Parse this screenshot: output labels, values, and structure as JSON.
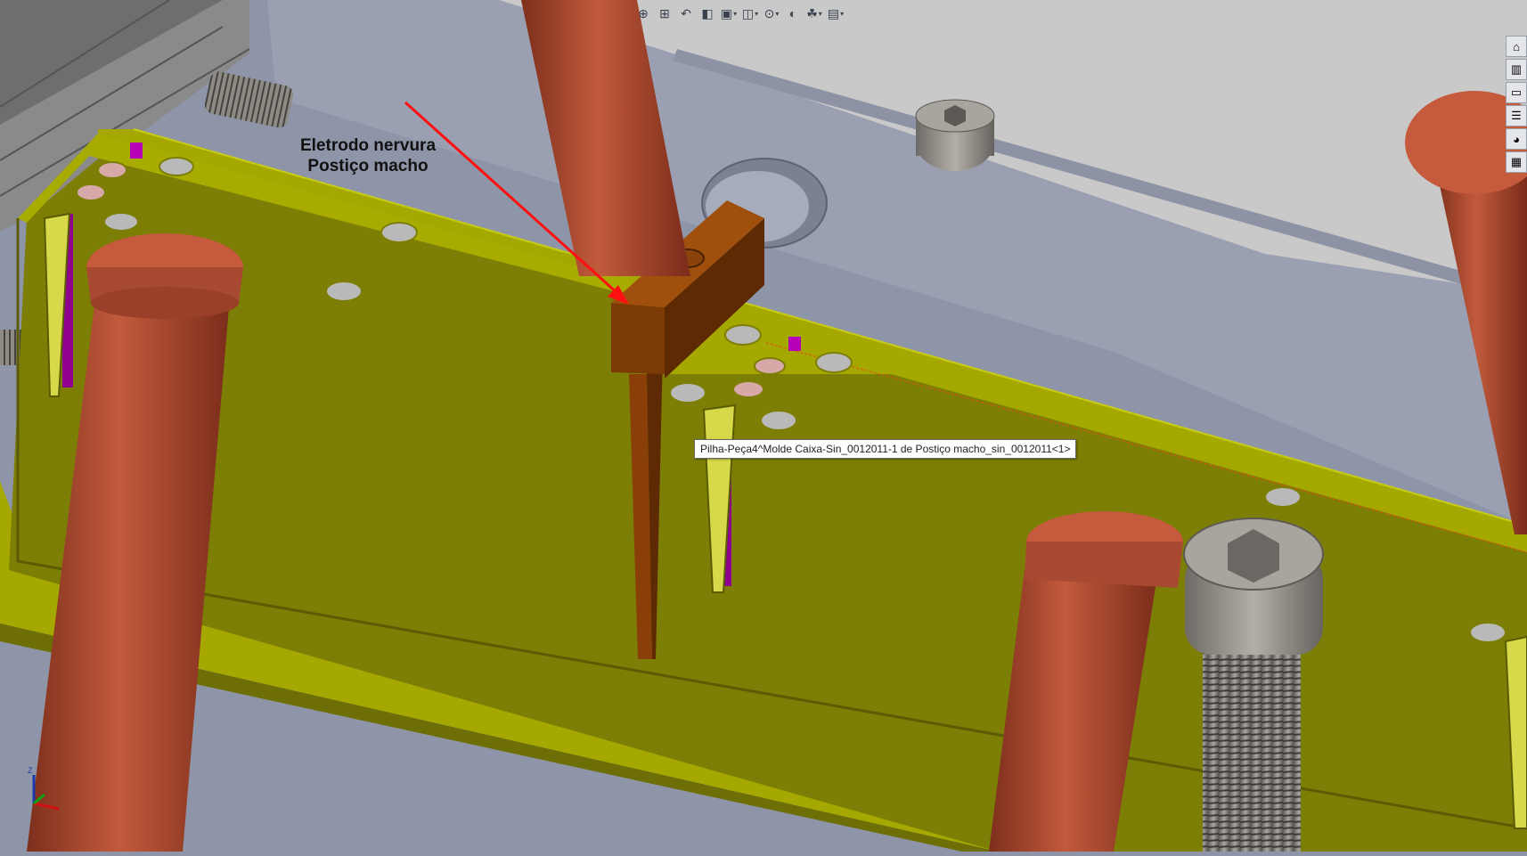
{
  "annotation": {
    "line1": "Eletrodo nervura",
    "line2": "Postiço macho"
  },
  "tooltip": {
    "text": "Pilha-Peça4^Molde Caixa-Sin_0012011-1 de Postiço macho_sin_0012011<1>"
  },
  "triad": {
    "z_label": "Z"
  },
  "hud_toolbar": {
    "icons": [
      "zoom-to-fit-icon",
      "zoom-area-icon",
      "previous-view-icon",
      "section-view-icon",
      "view-orientation-icon",
      "display-style-icon",
      "hide-show-items-icon",
      "edit-appearance-icon",
      "apply-scene-icon",
      "view-settings-icon"
    ]
  },
  "task_pane": {
    "icons": [
      "home-icon",
      "resources-icon",
      "file-explorer-icon",
      "view-palette-icon",
      "appearances-icon",
      "custom-properties-icon"
    ]
  },
  "colors": {
    "background": "#8f95a8",
    "plate_top": "#a4a800",
    "plate_face": "#7d7e05",
    "pin": "#b85438",
    "electrode": "#7c3a05",
    "bolt": "#9c9892",
    "arrow": "#ff1010",
    "ejector_pin": "#b600b6"
  }
}
